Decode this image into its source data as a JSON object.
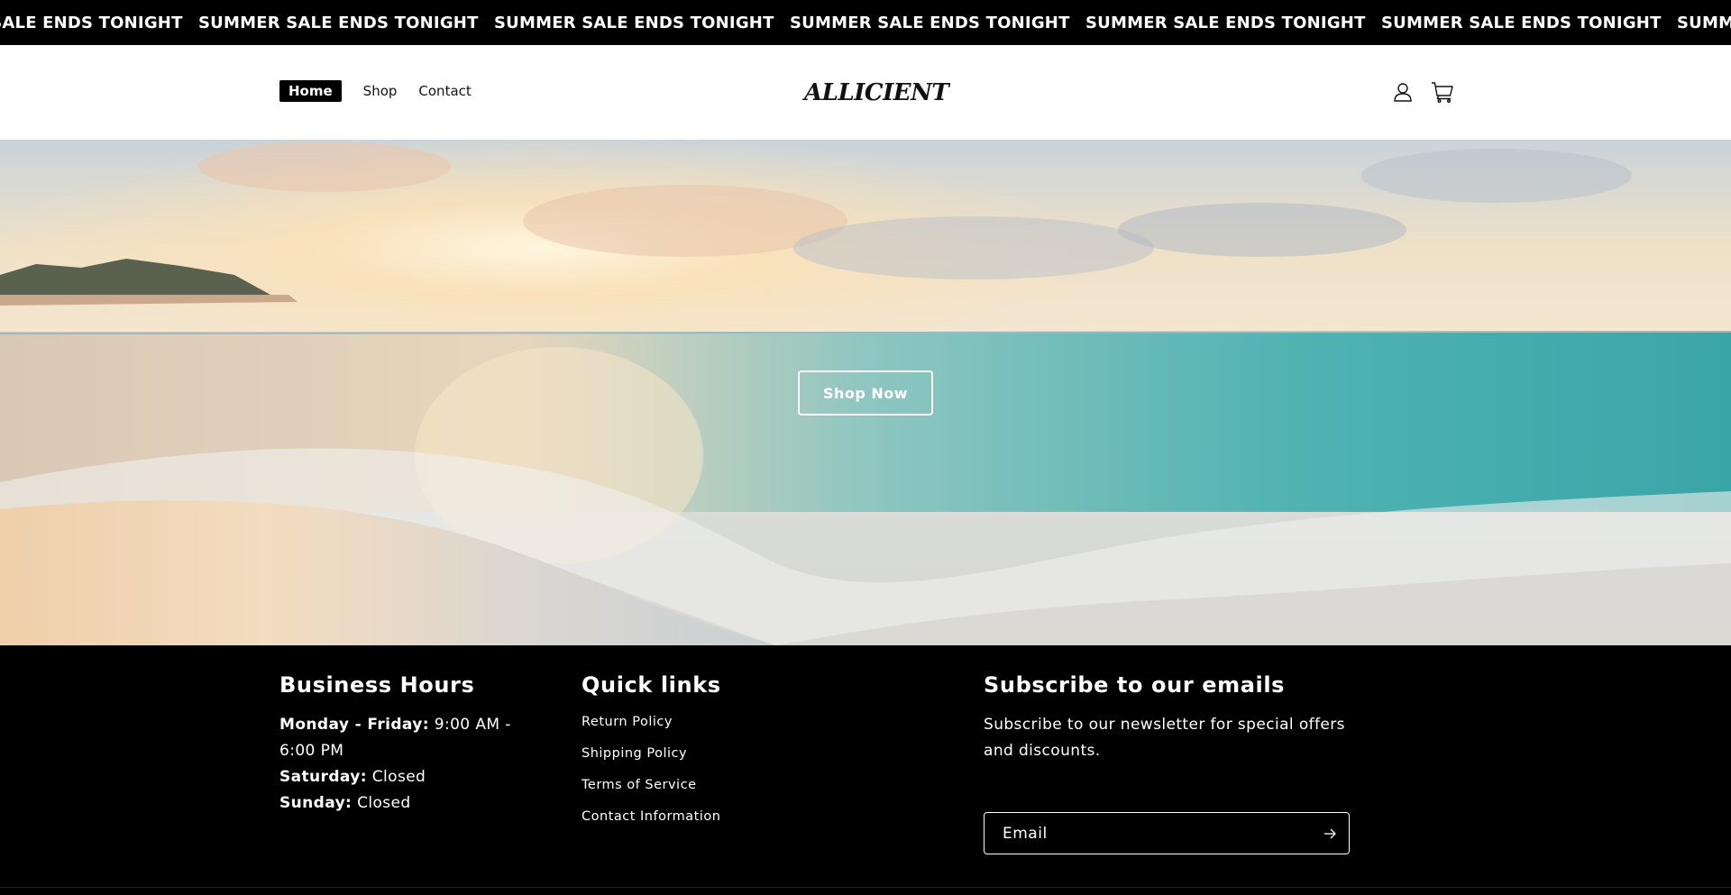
{
  "announcement": {
    "text": "SUMMER SALE ENDS TONIGHT",
    "repeats": [
      "SUMMER SALE ENDS TONIGHT",
      "SUMMER SALE ENDS TONIGHT",
      "SUMMER SALE ENDS TONIGHT",
      "SUMMER SALE ENDS TONIGHT",
      "SUMMER SALE ENDS TONIGHT",
      "SUMMER SALE ENDS TONIGHT",
      "SUMMER SALE ENDS TONIGHT"
    ]
  },
  "header": {
    "nav": [
      {
        "label": "Home",
        "active": true
      },
      {
        "label": "Shop",
        "active": false
      },
      {
        "label": "Contact",
        "active": false
      }
    ],
    "logo": "ALLICIENT",
    "icons": [
      "account-icon",
      "cart-icon"
    ]
  },
  "hero": {
    "button_label": "Shop Now",
    "image": "beach-sunset-photo"
  },
  "footer": {
    "hours": {
      "heading": "Business Hours",
      "lines": [
        {
          "day": "Monday - Friday:",
          "time": "9:00 AM - 6:00 PM"
        },
        {
          "day": "Saturday:",
          "time": "Closed"
        },
        {
          "day": "Sunday:",
          "time": "Closed"
        }
      ]
    },
    "links": {
      "heading": "Quick links",
      "items": [
        "Return Policy",
        "Shipping Policy",
        "Terms of Service",
        "Contact Information"
      ]
    },
    "subscribe": {
      "heading": "Subscribe to our emails",
      "text": "Subscribe to our newsletter for special offers and discounts.",
      "email_placeholder": "Email"
    }
  },
  "colors": {
    "announcement_bg": "#000000",
    "header_bg": "#ffffff",
    "footer_bg": "#000000",
    "sea": "#5fb8b6"
  }
}
